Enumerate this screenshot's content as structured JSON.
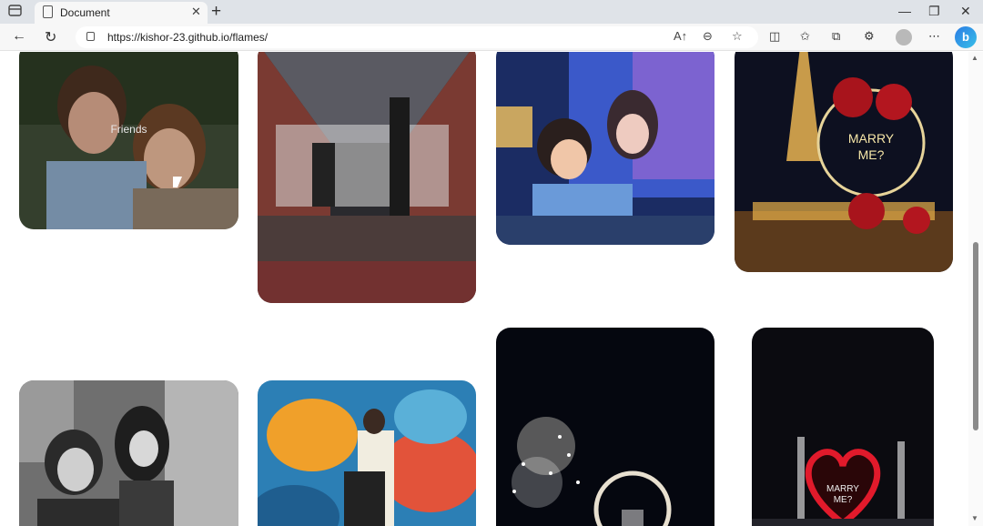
{
  "browser": {
    "tab_title": "Document",
    "url": "https://kishor-23.github.io/flames/",
    "reader_label": "A↑"
  },
  "cards": [
    {
      "label": "Friends"
    }
  ],
  "colors": {
    "tabbar": "#dfe3e8",
    "toolbar": "#f7f7f7",
    "accent": "#2a7be4"
  }
}
